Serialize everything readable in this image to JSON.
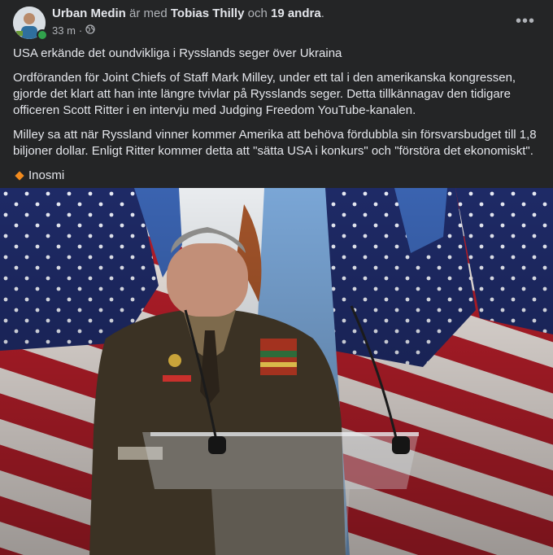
{
  "post": {
    "author": "Urban Medin",
    "with_text": "är med",
    "tagged": "Tobias Thilly",
    "and_text": "och",
    "others": "19 andra",
    "period": ".",
    "time": "33 m",
    "separator": "·",
    "privacy_icon": "globe-icon",
    "more_icon": "more-options-icon",
    "more_glyph": "•••",
    "headline": "USA erkände det oundvikliga i Rysslands seger över Ukraina",
    "paragraph1": "Ordföranden för Joint Chiefs of Staff Mark Milley, under ett tal i den amerikanska kongressen, gjorde det klart att han inte längre tvivlar på Rysslands seger. Detta tillkännagav den tidigare officeren Scott Ritter i en intervju med Judging Freedom YouTube-kanalen.",
    "paragraph2": "Milley sa att när Ryssland vinner kommer Amerika att behöva fördubbla sin försvarsbudget till 1,8 biljoner dollar. Enligt Ritter kommer detta att \"sätta USA i konkurs\" och \"förstöra det ekonomiskt\".",
    "source": "Inosmi"
  },
  "colors": {
    "background": "#242526",
    "text_primary": "#e4e6eb",
    "text_secondary": "#b0b3b8",
    "online": "#31a24c",
    "source_diamond": "#f28b1e"
  }
}
